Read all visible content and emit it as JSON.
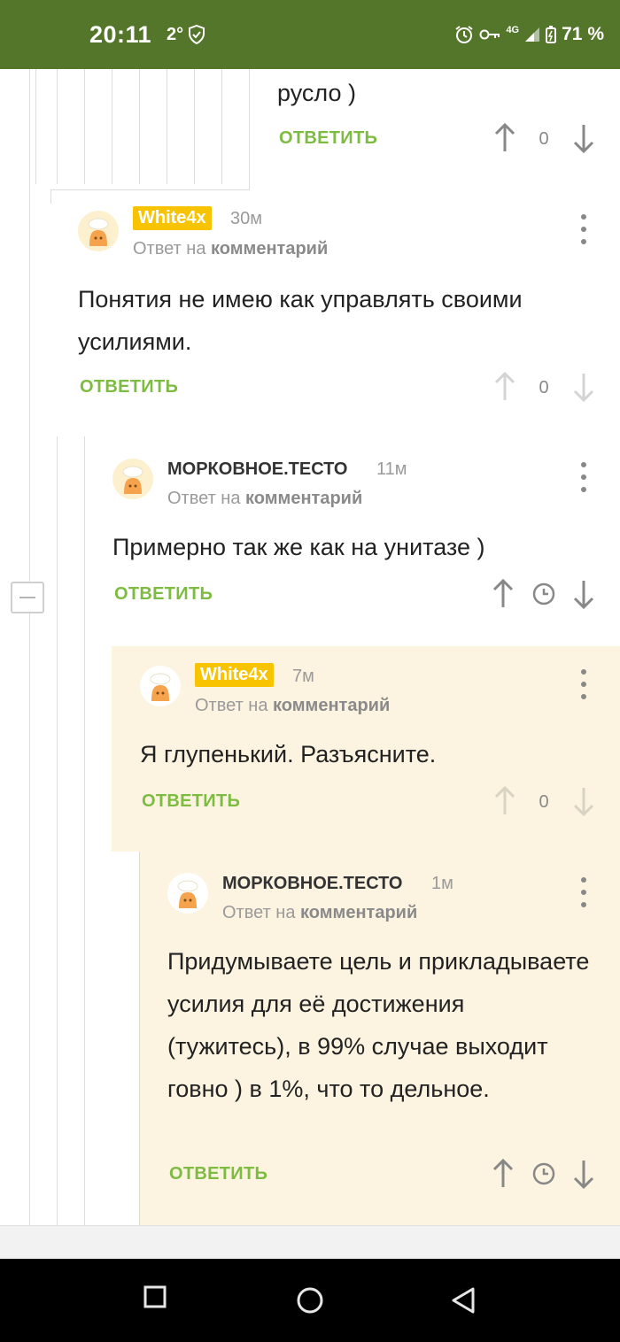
{
  "status_bar": {
    "time": "20:11",
    "notification": "2°",
    "network": "4G",
    "battery": "71 %"
  },
  "colors": {
    "status_bar": "#54762a",
    "reply": "#7dbc41",
    "badge": "#f8c300",
    "highlight": "#fcf4e1"
  },
  "top_fragment": {
    "text": "русло )",
    "reply_label": "ОТВЕТИТЬ",
    "score": "0"
  },
  "comments": [
    {
      "author": "White4x",
      "time": "30м",
      "reply_to_prefix": "Ответ на",
      "reply_to_link": "комментарий",
      "text": "Понятия не имею как управлять своими усилиями.",
      "reply_label": "ОТВЕТИТЬ",
      "score": "0"
    },
    {
      "author": "МОРКОВНОЕ.ТЕСТО",
      "time": "11м",
      "reply_to_prefix": "Ответ на",
      "reply_to_link": "комментарий",
      "text": "Примерно так же как на унитазе )",
      "reply_label": "ОТВЕТИТЬ"
    },
    {
      "author": "White4x",
      "time": "7м",
      "reply_to_prefix": "Ответ на",
      "reply_to_link": "комментарий",
      "text": "Я глупенький. Разъясните.",
      "reply_label": "ОТВЕТИТЬ",
      "score": "0"
    },
    {
      "author": "МОРКОВНОЕ.ТЕСТО",
      "time": "1м",
      "reply_to_prefix": "Ответ на",
      "reply_to_link": "комментарий",
      "text": "Придумываете цель и прикладываете усилия для её достижения (тужитесь), в 99% случае выходит говно ) в 1%, что то дельное.",
      "reply_label": "ОТВЕТИТЬ"
    }
  ],
  "icons": {
    "upvote": "arrow-up-icon",
    "downvote": "arrow-down-icon",
    "timer": "clock-icon",
    "menu": "more-vertical-icon",
    "collapse": "minus-icon",
    "nav_recent": "square-icon",
    "nav_home": "circle-icon",
    "nav_back": "triangle-back-icon"
  }
}
